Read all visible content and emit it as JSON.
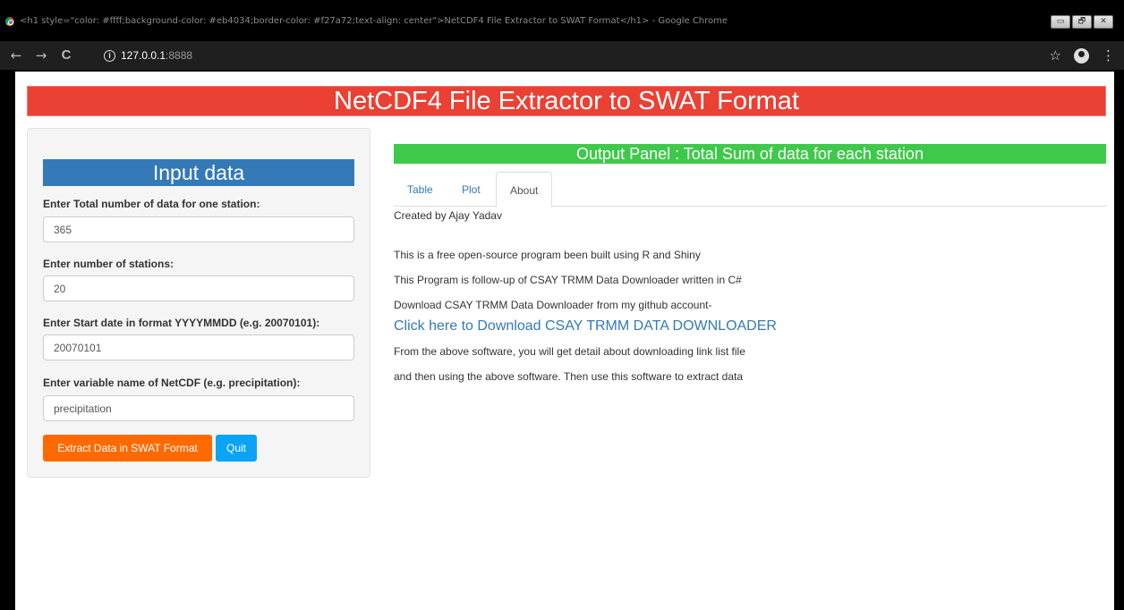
{
  "window": {
    "title": "<h1 style=\"color: #ffff;background-color: #eb4034;border-color: #f27a72;text-align: center\">NetCDF4 File Extractor to SWAT Format</h1> - Google Chrome",
    "controls": {
      "minimize": "▭",
      "restore": "🗗",
      "close": "✕"
    }
  },
  "browser": {
    "back_icon": "←",
    "forward_icon": "→",
    "reload_icon": "C",
    "info_icon": "i",
    "url_host": "127.0.0.1",
    "url_port": ":8888",
    "star_icon": "☆",
    "menu_icon": "⋮"
  },
  "page": {
    "title": "NetCDF4 File Extractor to SWAT Format",
    "title_bg": "#eb4034",
    "sidebar": {
      "heading": "Input data",
      "fields": [
        {
          "label": "Enter Total number of data for one station:",
          "value": "365"
        },
        {
          "label": "Enter number of stations:",
          "value": "20"
        },
        {
          "label": "Enter Start date in format YYYYMMDD (e.g. 20070101):",
          "value": "20070101"
        },
        {
          "label": "Enter variable name of NetCDF (e.g. precipitation):",
          "value": "precipitation"
        }
      ],
      "extract_button": "Extract Data in SWAT Format",
      "quit_button": "Quit"
    },
    "main": {
      "heading": "Output Panel : Total Sum of data for each station",
      "tabs": [
        {
          "label": "Table",
          "active": false
        },
        {
          "label": "Plot",
          "active": false
        },
        {
          "label": "About",
          "active": true
        }
      ],
      "about": {
        "author": "Created by Ajay Yadav",
        "line1": "This is a free open-source program been built using R and Shiny",
        "line2": "This Program is follow-up of CSAY TRMM Data Downloader written in C#",
        "line3": "Download CSAY TRMM Data Downloader from my github account-",
        "link": "Click here to Download CSAY TRMM DATA DOWNLOADER",
        "line4": "From the above software, you will get detail about downloading link list file",
        "line5": "and then using the above software. Then use this software to extract data"
      }
    }
  }
}
